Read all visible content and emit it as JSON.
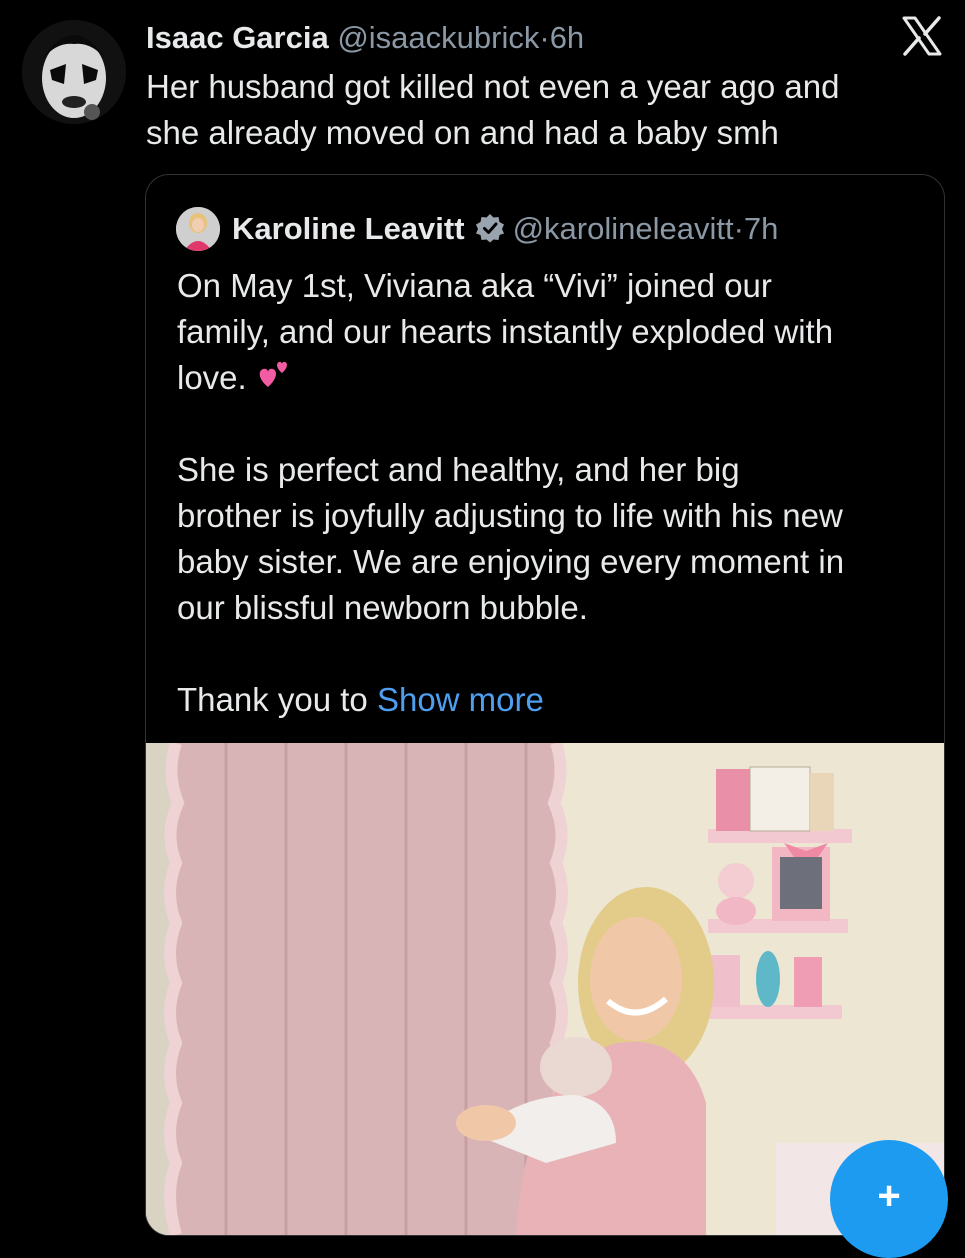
{
  "tweet": {
    "author_name": "Isaac Garcia",
    "handle": "@isaackubrick",
    "separator": "·",
    "time": "6h",
    "text_line1": "Her husband got killed not even a year ago and",
    "text_line2": "she already moved on and had a baby smh",
    "avatar_icon": "corpse-paint-avatar",
    "brand_icon": "x-logo-icon"
  },
  "quoted": {
    "author_name": "Karoline Leavitt",
    "verified_icon": "verified-badge-icon",
    "handle": "@karolineleavitt",
    "separator": "·",
    "time": "7h",
    "para1_line1": "On May 1st, Viviana aka “Vivi” joined our",
    "para1_line2": "family, and our hearts instantly exploded with",
    "para1_line3": "love.",
    "emoji_icon": "two-hearts-emoji",
    "para2_line1": "She is perfect and healthy, and her big",
    "para2_line2": "brother is joyfully adjusting to life with his new",
    "para2_line3": "baby sister. We are enjoying every moment in",
    "para2_line4": "our blissful newborn bubble.",
    "para3_prefix": "Thank you to ",
    "show_more": "Show more",
    "photo_icon": "nursery-photo"
  },
  "fab": {
    "label": "+",
    "icon": "compose-icon"
  },
  "colors": {
    "background": "#000000",
    "text": "#e7e9ea",
    "muted": "#8b98a5",
    "link": "#4f9ff0",
    "accent": "#1d9bf0",
    "border": "#2f3336"
  }
}
